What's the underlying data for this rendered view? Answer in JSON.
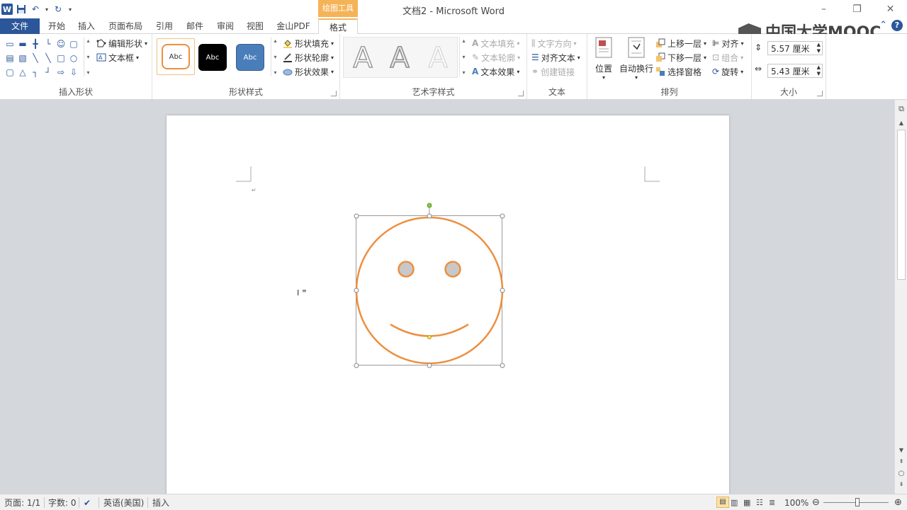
{
  "window": {
    "title": "文档2 - Microsoft Word",
    "context_tab_title": "绘图工具",
    "minimize": "–",
    "restore": "❐",
    "close": "✕"
  },
  "brand": {
    "text": "中国大学MOOC"
  },
  "help_icon": "?",
  "tabs": {
    "file": "文件",
    "items": [
      "开始",
      "插入",
      "页面布局",
      "引用",
      "邮件",
      "审阅",
      "视图",
      "金山PDF",
      "格式"
    ]
  },
  "ribbon": {
    "insert_shapes": {
      "label": "插入形状",
      "edit_shape": "编辑形状",
      "text_box": "文本框"
    },
    "shape_styles": {
      "label": "形状样式",
      "preset1": "Abc",
      "preset2": "Abc",
      "preset3": "Abc",
      "fill": "形状填充",
      "outline": "形状轮廓",
      "effects": "形状效果"
    },
    "wordart_styles": {
      "label": "艺术字样式",
      "letter": "A",
      "text_fill": "文本填充",
      "text_outline": "文本轮廓",
      "text_effects": "文本效果"
    },
    "text": {
      "label": "文本",
      "direction": "文字方向",
      "align_text": "对齐文本",
      "create_link": "创建链接"
    },
    "arrange": {
      "label": "排列",
      "position": "位置",
      "wrap": "自动换行",
      "bring_forward": "上移一层",
      "send_backward": "下移一层",
      "selection_pane": "选择窗格",
      "align": "对齐",
      "group": "组合",
      "rotate": "旋转"
    },
    "size": {
      "label": "大小",
      "height": "5.57 厘米",
      "width": "5.43 厘米"
    }
  },
  "status": {
    "page": "页面: 1/1",
    "words": "字数: 0",
    "language": "英语(美国)",
    "mode": "插入",
    "zoom": "100%"
  },
  "colors": {
    "word_blue": "#2b579a",
    "contextual_orange": "#f5b358",
    "shape_outline": "#ed8f3f",
    "eye_fill": "#c8c8c8"
  }
}
